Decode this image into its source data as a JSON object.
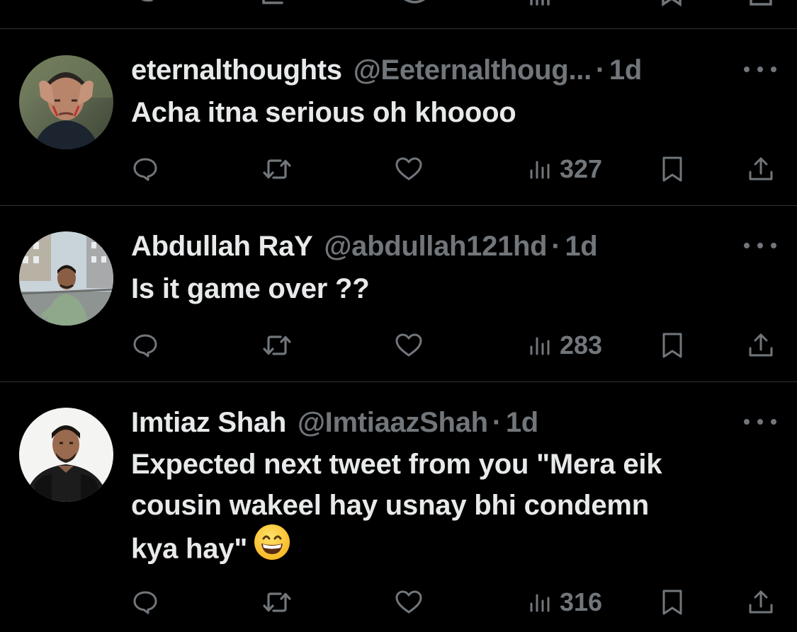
{
  "replies": [
    {
      "display_name": "eternalthoughts",
      "handle": "@Eeternalthoug...",
      "separator": "·",
      "time": "1d",
      "text": "Acha itna serious oh khoooo",
      "views": "327",
      "avatar_icon": "man-hands-on-head-avatar"
    },
    {
      "display_name": "Abdullah RaY",
      "handle": "@abdullah121hd",
      "separator": "·",
      "time": "1d",
      "text": "Is it game over ??",
      "views": "283",
      "avatar_icon": "man-green-hoodie-avatar"
    },
    {
      "display_name": "Imtiaz Shah",
      "handle": "@ImtiaazShah",
      "separator": "·",
      "time": "1d",
      "text_lines": [
        "Expected next tweet from you \"Mera eik",
        "cousin wakeel hay usnay bhi condemn",
        "kya hay\""
      ],
      "emoji": "grinning-face-emoji",
      "views": "316",
      "avatar_icon": "man-black-shirt-avatar"
    }
  ],
  "colors": {
    "background": "#000000",
    "primary_text": "#e7e9ea",
    "secondary_text": "#71767b",
    "divider": "#2f3336"
  }
}
